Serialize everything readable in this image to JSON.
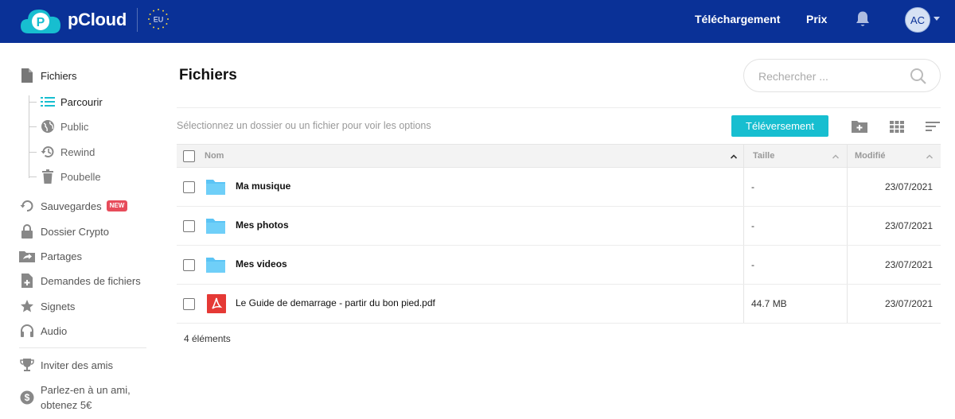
{
  "header": {
    "brand": "pCloud",
    "region_badge": "EU",
    "nav": {
      "download": "Téléchargement",
      "pricing": "Prix"
    },
    "avatar_initials": "AC",
    "colors": {
      "bar": "#0a3197",
      "logo": "#17bed0"
    }
  },
  "sidebar": {
    "files": "Fichiers",
    "sub": {
      "browse": "Parcourir",
      "public": "Public",
      "rewind": "Rewind",
      "trash": "Poubelle"
    },
    "backups": "Sauvegardes",
    "new_badge": "NEW",
    "crypto": "Dossier Crypto",
    "shares": "Partages",
    "file_requests": "Demandes de fichiers",
    "bookmarks": "Signets",
    "audio": "Audio",
    "invite": "Inviter des amis",
    "refer_line1": "Parlez-en à un ami,",
    "refer_line2": "obtenez 5€"
  },
  "main": {
    "title": "Fichiers",
    "search_placeholder": "Rechercher ...",
    "hint": "Sélectionnez un dossier ou un fichier pour voir les options",
    "upload_button": "Téléversement",
    "columns": {
      "name": "Nom",
      "size": "Taille",
      "modified": "Modifié"
    },
    "rows": [
      {
        "name": "Ma musique",
        "type": "folder",
        "size": "-",
        "modified": "23/07/2021"
      },
      {
        "name": "Mes photos",
        "type": "folder",
        "size": "-",
        "modified": "23/07/2021"
      },
      {
        "name": "Mes videos",
        "type": "folder",
        "size": "-",
        "modified": "23/07/2021"
      },
      {
        "name": "Le Guide de demarrage - partir du bon pied.pdf",
        "type": "pdf",
        "size": "44.7 MB",
        "modified": "23/07/2021"
      }
    ],
    "count": "4 éléments",
    "colors": {
      "accent": "#17bed0",
      "folder": "#5bc4f5",
      "pdf": "#e53935",
      "new_badge": "#e74c5b"
    }
  }
}
